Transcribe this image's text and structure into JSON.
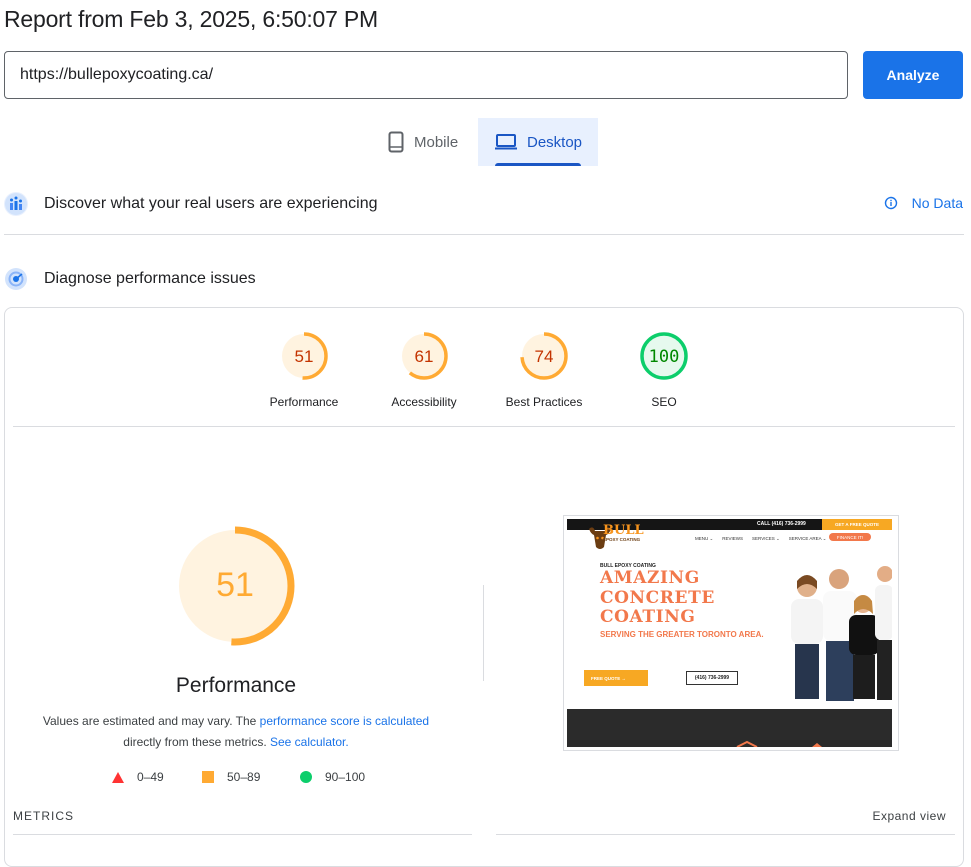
{
  "header": {
    "title": "Report from Feb 3, 2025, 6:50:07 PM"
  },
  "url_bar": {
    "value": "https://bullepoxycoating.ca/",
    "analyze_label": "Analyze"
  },
  "tabs": [
    {
      "label": "Mobile",
      "icon": "smartphone-icon",
      "selected": false
    },
    {
      "label": "Desktop",
      "icon": "laptop-icon",
      "selected": true
    }
  ],
  "field_data": {
    "title": "Discover what your real users are experiencing",
    "status": "No Data",
    "icon": "crux-icon"
  },
  "lab_data": {
    "title": "Diagnose performance issues",
    "icon": "lighthouse-icon"
  },
  "scores": [
    {
      "label": "Performance",
      "value": 51,
      "color": "#fa3",
      "track": "#fff3e0",
      "text_color": "#c33300"
    },
    {
      "label": "Accessibility",
      "value": 61,
      "color": "#fa3",
      "track": "#fff3e0",
      "text_color": "#c33300"
    },
    {
      "label": "Best Practices",
      "value": 74,
      "color": "#fa3",
      "track": "#fff3e0",
      "text_color": "#c33300"
    },
    {
      "label": "SEO",
      "value": 100,
      "color": "#0cce6b",
      "track": "#e6f9ee",
      "text_color": "#008800"
    }
  ],
  "performance": {
    "score": "51",
    "score_value": 51,
    "title": "Performance",
    "note_prefix": "Values are estimated and may vary. The ",
    "note_link": "performance score is calculated",
    "note_middle": " directly from these metrics. ",
    "note_link2": "See calculator.",
    "legend": [
      {
        "range": "0–49",
        "shape": "triangle",
        "color": "#f33"
      },
      {
        "range": "50–89",
        "shape": "square",
        "color": "#fa3"
      },
      {
        "range": "90–100",
        "shape": "circle",
        "color": "#0cce6b"
      }
    ]
  },
  "screenshot": {
    "phone": "CALL (416) 736-2999",
    "quote_top": "GET A FREE QUOTE",
    "logo_text": "BULL",
    "logo_sub": "EPOXY COATING",
    "nav": [
      "MENU ⌄",
      "REVIEWS",
      "SERVICES ⌄",
      "SERVICE AREA ⌄"
    ],
    "finance": "FINANCE IT!",
    "eyebrow": "BULL EPOXY COATING",
    "headline": [
      "AMAZING",
      "CONCRETE",
      "COATING"
    ],
    "subhead": "SERVING THE GREATER TORONTO AREA.",
    "cta": "FREE QUOTE →",
    "phone_box": "(416) 736-2999"
  },
  "metrics": {
    "label": "METRICS",
    "expand_label": "Expand view"
  }
}
